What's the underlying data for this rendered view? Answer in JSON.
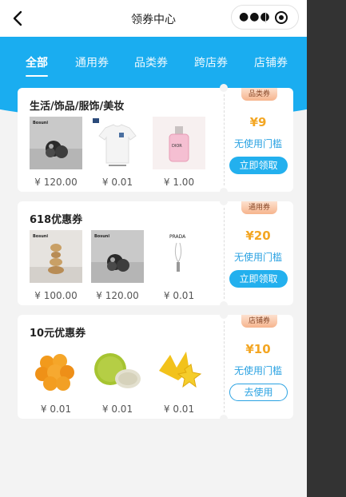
{
  "nav": {
    "title": "领券中心"
  },
  "tabs": [
    "全部",
    "通用券",
    "品类券",
    "跨店券",
    "店铺券"
  ],
  "coupons": [
    {
      "name": "生活/饰品/服饰/美妆",
      "badge": "品类券",
      "amount": "¥9",
      "condition": "无使用门槛",
      "action": "立即领取",
      "items": [
        {
          "price": "¥ 120.00",
          "label": "Bosuni"
        },
        {
          "price": "¥ 0.01"
        },
        {
          "price": "¥ 1.00",
          "label": "DIOR"
        }
      ]
    },
    {
      "name": "618优惠券",
      "badge": "通用券",
      "amount": "¥20",
      "condition": "无使用门槛",
      "action": "立即领取",
      "items": [
        {
          "price": "¥ 100.00",
          "label": "Bosuni"
        },
        {
          "price": "¥ 120.00",
          "label": "Bosuni"
        },
        {
          "price": "¥ 0.01",
          "label": "PRADA"
        }
      ]
    },
    {
      "name": "10元优惠券",
      "badge": "店铺券",
      "amount": "¥10",
      "condition": "无使用门槛",
      "action": "去使用",
      "items": [
        {
          "price": "¥ 0.01"
        },
        {
          "price": "¥ 0.01"
        },
        {
          "price": "¥ 0.01"
        }
      ]
    }
  ],
  "colors": {
    "primary": "#1aadf0",
    "amount": "#f3a623"
  }
}
